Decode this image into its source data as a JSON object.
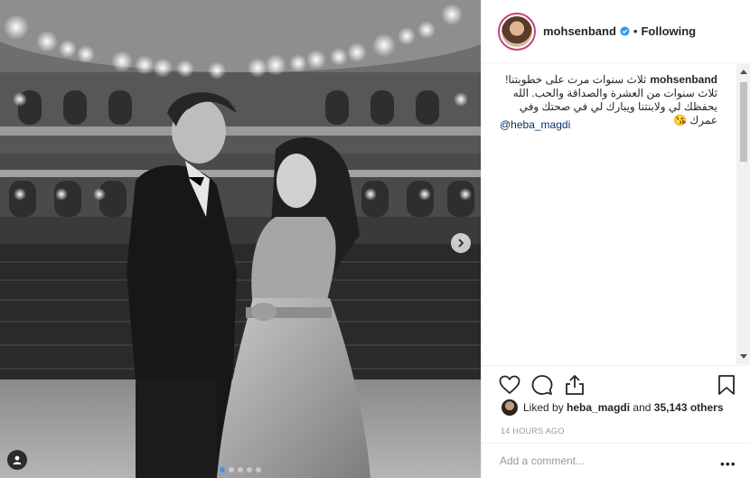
{
  "post": {
    "username": "mohsenband",
    "separator": "•",
    "follow_state": "Following"
  },
  "caption": {
    "username": "mohsenband",
    "text": "ثلاث سنوات مرت على خطوبتنا! ثلاث سنوات من العشرة والصداقة والحب. الله يحفظك لي ولابنتنا ويبارك لي في صحتك وفي عمرك",
    "emoji": "😘",
    "mention": "@heba_magdi"
  },
  "likes": {
    "prefix": "Liked by",
    "user": "heba_magdi",
    "middle": "and",
    "count": "35,143 others"
  },
  "timestamp": "14 HOURS AGO",
  "comment": {
    "placeholder": "Add a comment..."
  },
  "carousel": {
    "total": 5,
    "current": 1
  },
  "colors": {
    "link": "#003569",
    "accent": "#3897f0",
    "story_ring": "#c6417e"
  },
  "icons": [
    "verified-icon",
    "heart-icon",
    "comment-icon",
    "share-icon",
    "bookmark-icon",
    "chevron-right-icon",
    "user-tag-icon",
    "more-icon"
  ]
}
